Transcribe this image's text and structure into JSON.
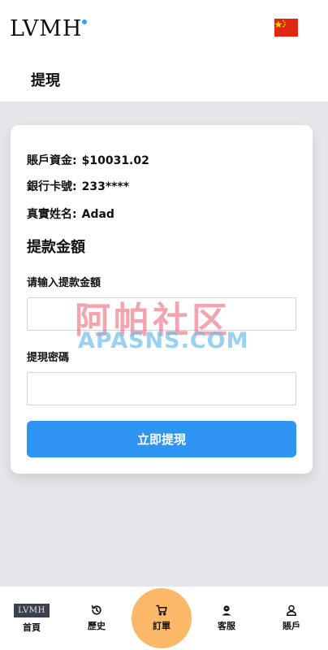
{
  "header": {
    "logo": "LVMH",
    "flag_icon": "china-flag-icon",
    "title": "提現"
  },
  "account": {
    "balance_label": "賬戶資金:",
    "balance_value": "$10031.02",
    "card_label": "銀行卡號:",
    "card_value": "233****",
    "name_label": "真實姓名:",
    "name_value": "Adad"
  },
  "withdraw": {
    "section_title": "提款金額",
    "amount_label": "请输入提款金額",
    "amount_value": "",
    "password_label": "提現密碼",
    "password_value": "",
    "submit_label": "立即提現"
  },
  "watermark": {
    "cn": "阿帕社区",
    "en": "APASNS.COM"
  },
  "bottom_nav": {
    "home_thumb": "LVMH",
    "home": "首頁",
    "history": "歷史",
    "order": "訂單",
    "service": "客服",
    "account": "賬戶"
  },
  "colors": {
    "primary": "#2e95f4",
    "order_accent": "#fbb869",
    "page_bg": "#e6e7eb",
    "flag_red": "#de2910",
    "flag_yellow": "#ffde00"
  }
}
